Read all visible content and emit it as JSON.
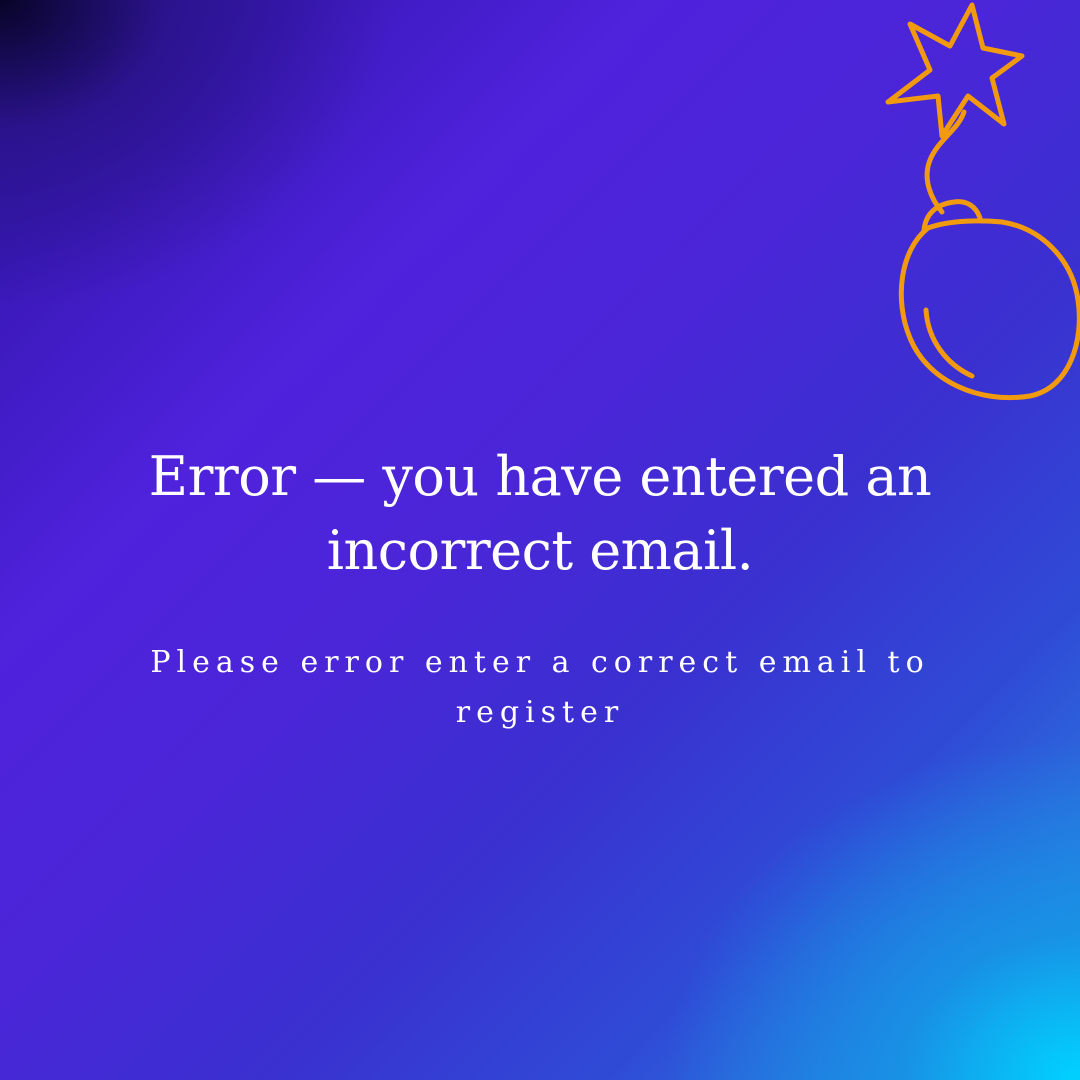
{
  "message": {
    "headline": "Error — you have entered an incorrect email.",
    "subtext": "Please error enter a correct email to register"
  },
  "decoration": {
    "icon": "bomb-icon",
    "color": "#f29a0f"
  },
  "colors": {
    "background_top_left": "#0a0630",
    "background_mid": "#4f22dc",
    "background_bottom_right": "#00d2ff",
    "text": "#ffffff"
  }
}
